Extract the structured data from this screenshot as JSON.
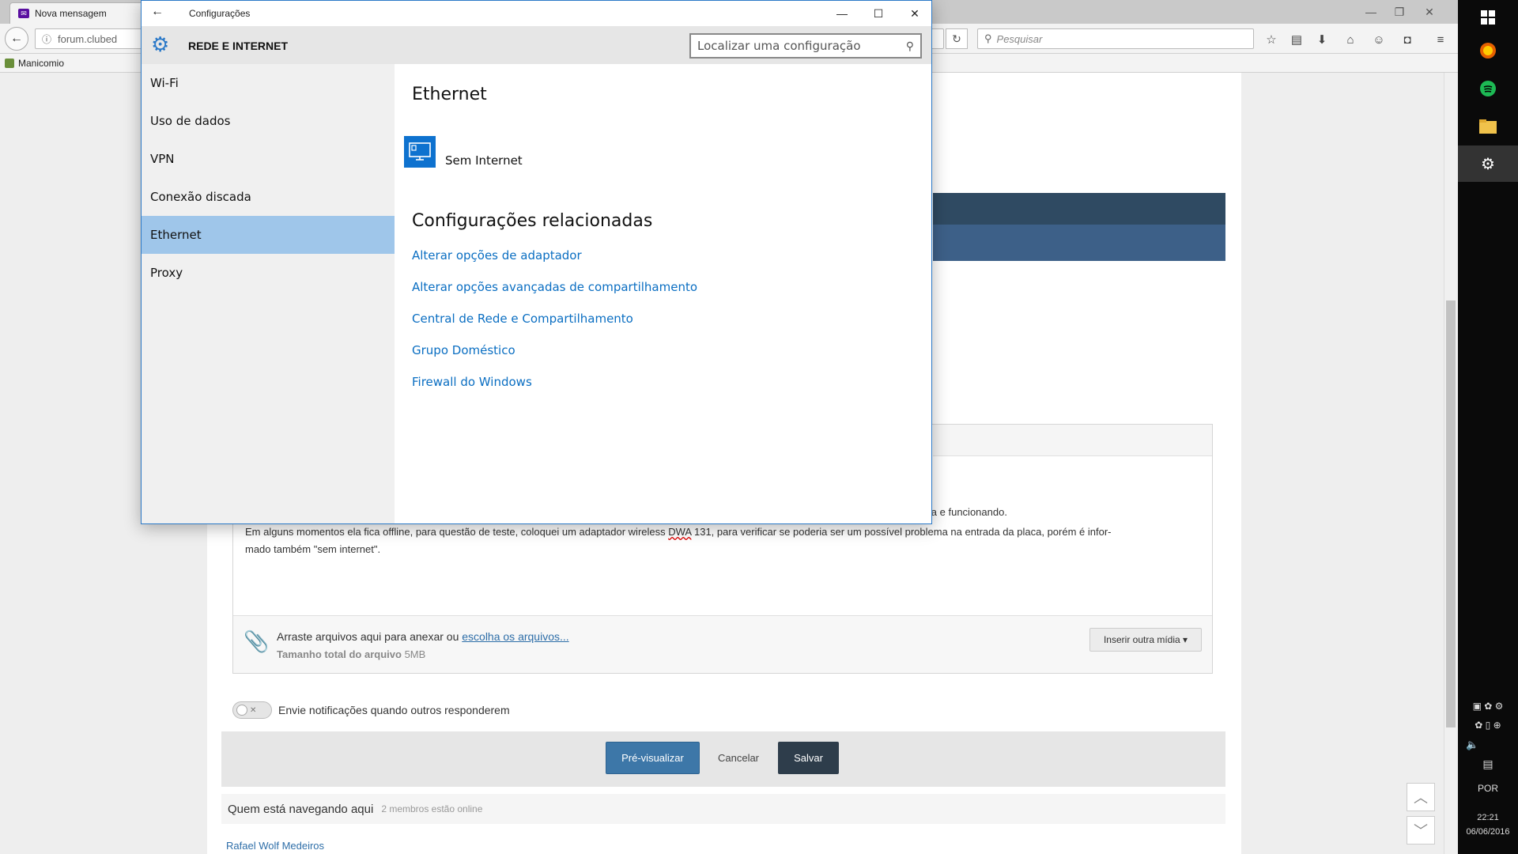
{
  "browser": {
    "tab_title": "Nova mensagem",
    "url": "forum.clubed",
    "search_placeholder": "Pesquisar",
    "bookmark": "Manicomio"
  },
  "post": {
    "line0": "ectada e funcionando.",
    "line1a": "Em alguns momentos ela fica offline, para questão de teste, coloquei um adaptador wireless ",
    "line1b": "DWA",
    "line1c": " 131, para verificar se poderia ser um possível problema na entrada da placa, porém é infor-",
    "line2": "mado também \"sem internet\"."
  },
  "attach": {
    "text": "Arraste arquivos aqui para anexar ou ",
    "link": "escolha os arquivos...",
    "size_label": "Tamanho total do arquivo",
    "size_value": "5MB",
    "insert_media": "Inserir outra mídia ▾"
  },
  "notify_label": "Envie notificações quando outros responderem",
  "form": {
    "preview": "Pré-visualizar",
    "cancel": "Cancelar",
    "save": "Salvar"
  },
  "online": {
    "title": "Quem está navegando aqui",
    "count": "2 membros estão online",
    "user": "Rafael Wolf Medeiros"
  },
  "tray": {
    "lang": "POR",
    "time": "22:21",
    "date": "06/06/2016"
  },
  "settings": {
    "window_title": "Configurações",
    "category": "REDE E INTERNET",
    "search_placeholder": "Localizar uma configuração",
    "nav": [
      "Wi-Fi",
      "Uso de dados",
      "VPN",
      "Conexão discada",
      "Ethernet",
      "Proxy"
    ],
    "active_nav": "Ethernet",
    "section_title": "Ethernet",
    "status": "Sem Internet",
    "related_title": "Configurações relacionadas",
    "links": [
      "Alterar opções de adaptador",
      "Alterar opções avançadas de compartilhamento",
      "Central de Rede e Compartilhamento",
      "Grupo Doméstico",
      "Firewall do Windows"
    ]
  },
  "colors": {
    "accent": "#2b79c8",
    "nav_active": "#9fc6ea",
    "link": "#0a6ec2"
  }
}
